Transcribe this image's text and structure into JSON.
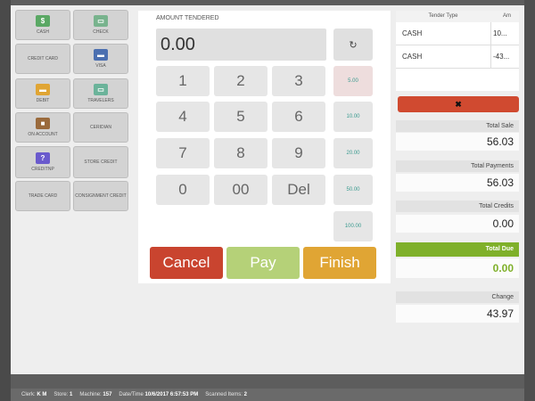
{
  "tender_types": [
    {
      "label": "CASH",
      "icon": "cash-icon"
    },
    {
      "label": "CHECK",
      "icon": "check-icon"
    },
    {
      "label": "CREDIT CARD",
      "icon": ""
    },
    {
      "label": "VISA",
      "icon": "visa-card-icon"
    },
    {
      "label": "DEBIT",
      "icon": "debit-card-icon"
    },
    {
      "label": "TRAVELERS",
      "icon": "travelers-check-icon"
    },
    {
      "label": "ON ACCOUNT",
      "icon": "account-icon"
    },
    {
      "label": "CERIDIAN",
      "icon": ""
    },
    {
      "label": "CREDITNP",
      "icon": "question-icon"
    },
    {
      "label": "STORE CREDIT",
      "icon": ""
    },
    {
      "label": "TRADE CARD",
      "icon": ""
    },
    {
      "label": "CONSIGNMENT CREDIT",
      "icon": ""
    }
  ],
  "amount": {
    "label": "AMOUNT TENDERED",
    "value": "0.00"
  },
  "keys": [
    "1",
    "2",
    "3",
    "4",
    "5",
    "6",
    "7",
    "8",
    "9",
    "0",
    "00",
    "Del"
  ],
  "quick_amounts": [
    "5.00",
    "10.00",
    "20.00",
    "50.00",
    "100.00"
  ],
  "actions": {
    "cancel": "Cancel",
    "pay": "Pay",
    "finish": "Finish"
  },
  "tenders_table": {
    "headers": [
      "Tender Type",
      "Am"
    ],
    "rows": [
      {
        "type": "CASH",
        "amount": "10..."
      },
      {
        "type": "CASH",
        "amount": "-43..."
      }
    ]
  },
  "totals": {
    "total_sale_label": "Total Sale",
    "total_sale": "56.03",
    "total_payments_label": "Total Payments",
    "total_payments": "56.03",
    "total_credits_label": "Total Credits",
    "total_credits": "0.00",
    "total_due_label": "Total Due",
    "total_due": "0.00",
    "change_label": "Change",
    "change": "43.97"
  },
  "status": {
    "clerk_label": "Clerk:",
    "clerk": "K M",
    "store_label": "Store:",
    "store": "1",
    "machine_label": "Machine:",
    "machine": "157",
    "datetime_label": "Date/Time",
    "datetime": "10/6/2017 6:57:53 PM",
    "scanned_label": "Scanned Items:",
    "scanned": "2"
  },
  "colors": {
    "cancel": "#c9442f",
    "pay": "#b5d178",
    "finish": "#e0a534",
    "due_green": "#7fb02a",
    "delete_red": "#d04a30"
  }
}
